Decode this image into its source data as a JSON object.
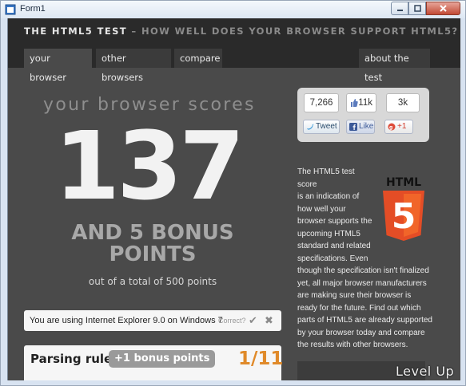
{
  "window": {
    "title": "Form1"
  },
  "header": {
    "title": "THE HTML5 TEST",
    "subtitle": " – HOW WELL DOES YOUR BROWSER SUPPORT HTML5?"
  },
  "tabs": [
    {
      "label": "your browser"
    },
    {
      "label": "other browsers"
    },
    {
      "label": "compare"
    },
    {
      "label": "about the test"
    }
  ],
  "score": {
    "heading": "your browser scores",
    "value": "137",
    "bonus_line1": "AND 5 BONUS",
    "bonus_line2": "POINTS",
    "total": "out of a total of 500 points"
  },
  "browser_detect": {
    "text": "You are using Internet Explorer 9.0 on Windows 7",
    "correct_label": "Correct?"
  },
  "parsing": {
    "title": "Parsing rules",
    "badge": "+1 bonus points",
    "score": "1/11"
  },
  "social": {
    "tweet_count": "7,266",
    "like_count": "11k",
    "plus_count": "3k",
    "tweet_label": "Tweet",
    "like_label": "Like",
    "plus_label": "+1"
  },
  "description": {
    "lines_short": [
      "The HTML5 test score",
      "is an indication of",
      "how well your",
      "browser supports the",
      "upcoming HTML5",
      "standard and related",
      "specifications. Even"
    ],
    "rest": "though the specification isn't finalized yet, all major browser manufacturers are making sure their browser is ready for the future. Find out which parts of HTML5 are already supported by your browser today and compare the results with other browsers."
  },
  "logo": {
    "text": "HTML",
    "number": "5",
    "color": "#e44d26"
  },
  "watermark": "Level Up"
}
